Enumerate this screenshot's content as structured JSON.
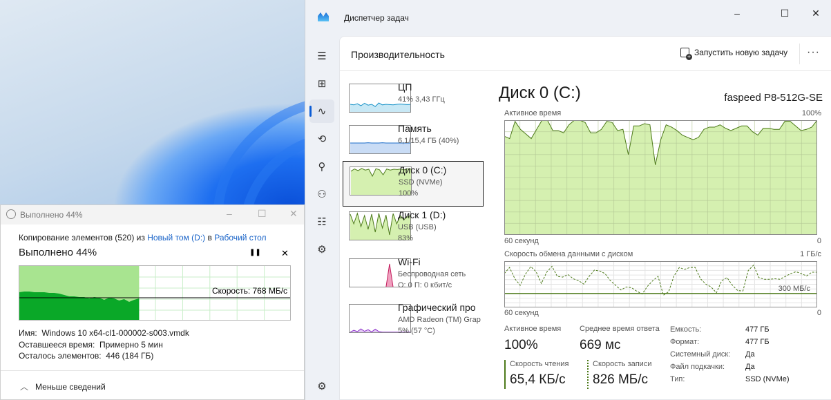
{
  "task_manager": {
    "title": "Диспетчер задач",
    "window_controls": {
      "minimize": "–",
      "maximize": "☐",
      "close": "✕"
    },
    "sidebar": [
      {
        "icon": "hamburger-icon",
        "glyph": "☰"
      },
      {
        "icon": "processes-icon",
        "glyph": "⊞"
      },
      {
        "icon": "performance-icon",
        "glyph": "∿",
        "active": true
      },
      {
        "icon": "history-icon",
        "glyph": "⟲"
      },
      {
        "icon": "startup-icon",
        "glyph": "⚲"
      },
      {
        "icon": "users-icon",
        "glyph": "⚇"
      },
      {
        "icon": "details-icon",
        "glyph": "☷"
      },
      {
        "icon": "services-icon",
        "glyph": "⚙"
      }
    ],
    "settings_glyph": "⚙",
    "header": {
      "title": "Производительность",
      "new_task": "Запустить новую задачу",
      "more": "···"
    },
    "resources": [
      {
        "name": "ЦП",
        "sub1": "41% 3,43 ГГц",
        "sub2": "",
        "line": "#1591c7",
        "fill": "#c8e8f5",
        "spark": [
          30,
          28,
          32,
          25,
          34,
          27,
          30,
          22,
          35,
          28,
          30,
          29,
          28,
          30,
          31,
          30,
          29,
          30
        ]
      },
      {
        "name": "Память",
        "sub1": "6,1/15,4 ГБ (40%)",
        "sub2": "",
        "line": "#1b6cc9",
        "fill": "#c9dcf5",
        "spark": [
          40,
          40,
          40,
          40,
          40,
          41,
          40,
          40,
          40,
          41,
          40,
          40,
          40,
          40,
          40,
          40,
          40,
          40
        ]
      },
      {
        "name": "Диск 0 (C:)",
        "sub1": "SSD (NVMe)",
        "sub2": "100%",
        "line": "#4d7a1a",
        "fill": "#d5f0b0",
        "spark": [
          88,
          96,
          90,
          98,
          92,
          95,
          70,
          97,
          93,
          75,
          96,
          92,
          95,
          94,
          96,
          93,
          97,
          95
        ],
        "selected": true
      },
      {
        "name": "Диск 1 (D:)",
        "sub1": "USB (USB)",
        "sub2": "83%",
        "line": "#4d7a1a",
        "fill": "#d5f0b0",
        "spark": [
          95,
          60,
          98,
          50,
          90,
          40,
          95,
          30,
          98,
          45,
          92,
          20,
          97,
          60,
          90,
          75,
          85,
          90
        ]
      },
      {
        "name": "Wi-Fi",
        "sub1": "Беспроводная сеть",
        "sub2": "О: 0 П: 0 кбит/с",
        "line": "#c21c5c",
        "fill": "#f0a0bf",
        "spark": [
          0,
          0,
          0,
          0,
          0,
          0,
          0,
          0,
          0,
          0,
          0,
          85,
          0,
          0,
          0,
          0,
          0,
          0
        ]
      },
      {
        "name": "Графический про",
        "sub1": "AMD Radeon (TM) Grap",
        "sub2": "5% (57 °C)",
        "line": "#8b2ec9",
        "fill": "#e2c9f3",
        "spark": [
          3,
          10,
          5,
          15,
          6,
          12,
          4,
          14,
          5,
          3,
          3,
          3,
          3,
          3,
          3,
          3,
          3,
          3
        ]
      }
    ],
    "detail": {
      "title": "Диск 0 (C:)",
      "model": "faspeed P8-512G-SE",
      "active_chart": {
        "label": "Активное время",
        "max_label": "100%",
        "x_left": "60 секунд",
        "x_right": "0",
        "color": "#4d7a1a",
        "fill": "#d5f0b0",
        "values": [
          86,
          84,
          99,
          92,
          88,
          84,
          92,
          100,
          100,
          91,
          91,
          89,
          96,
          100,
          100,
          98,
          89,
          89,
          92,
          99,
          98,
          91,
          92,
          70,
          95,
          95,
          97,
          96,
          61,
          83,
          96,
          94,
          91,
          87,
          85,
          83,
          85,
          92,
          94,
          94,
          96,
          93,
          91,
          93,
          95,
          95,
          90,
          87,
          93,
          93,
          92,
          92,
          99,
          99,
          95,
          91,
          92,
          94,
          100
        ],
        "ylim": [
          0,
          100
        ]
      },
      "transfer_chart": {
        "label": "Скорость обмена данными с диском",
        "max_label": "1 ГБ/с",
        "x_left": "60 секунд",
        "x_right": "0",
        "marker_label": "300 МБ/с",
        "marker_value": 300,
        "ylim": [
          0,
          1000
        ],
        "write_values": [
          731,
          863,
          619,
          477,
          721,
          883,
          772,
          518,
          761,
          888,
          670,
          655,
          711,
          619,
          579,
          503,
          670,
          807,
          787,
          731,
          579,
          477,
          376,
          442,
          426,
          350,
          289,
          457,
          579,
          670,
          264,
          340,
          680,
          863,
          822,
          863,
          863,
          619,
          503,
          442,
          315,
          579,
          645,
          482,
          365,
          355,
          797,
          914,
          645,
          609,
          609,
          619,
          609,
          670,
          731,
          772,
          731,
          680,
          761,
          761
        ]
      },
      "stats": {
        "active_time_label": "Активное время",
        "active_time": "100%",
        "response_label": "Среднее время ответа",
        "response": "669 мс",
        "read_label": "Скорость чтения",
        "read": "65,4 КБ/с",
        "write_label": "Скорость записи",
        "write": "826 МБ/с"
      },
      "props": [
        {
          "k": "Емкость:",
          "v": "477 ГБ"
        },
        {
          "k": "Формат:",
          "v": "477 ГБ"
        },
        {
          "k": "Системный диск:",
          "v": "Да"
        },
        {
          "k": "Файл подкачки:",
          "v": "Да"
        },
        {
          "k": "Тип:",
          "v": "SSD (NVMe)"
        }
      ]
    }
  },
  "copy_dialog": {
    "title": "Выполнено 44%",
    "line_prefix": "Копирование элементов (520) из ",
    "source": "Новый том (D:)",
    "mid": " в ",
    "dest": "Рабочий стол",
    "progress_title": "Выполнено 44%",
    "progress_percent": 44,
    "pause": "❚❚",
    "cancel": "✕",
    "speed": "Скорость: 768 МБ/с",
    "name_label": "Имя:",
    "name": "Windows 10 x64-cl1-000002-s003.vmdk",
    "time_label": "Оставшееся время:",
    "time": "Примерно 5 мин",
    "items_label": "Осталось элементов:",
    "items": "446 (184 ГБ)",
    "less": "Меньше сведений"
  }
}
